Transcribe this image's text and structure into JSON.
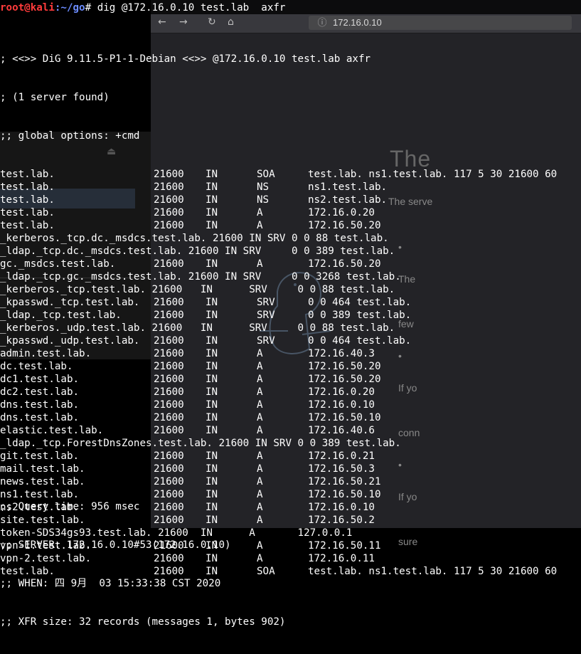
{
  "terminal": {
    "prompt_user": "root@kali",
    "prompt_path": ":~/go",
    "prompt_symbol": "# ",
    "command": "dig @172.16.0.10 test.lab  axfr",
    "header_lines": [
      "; <<>> DiG 9.11.5-P1-1-Debian <<>> @172.16.0.10 test.lab axfr",
      "; (1 server found)",
      ";; global options: +cmd"
    ],
    "records": [
      {
        "name": "test.lab.",
        "ttl": "21600",
        "class": "IN",
        "type": "SOA",
        "data": "test.lab. ns1.test.lab. 117 5 30 21600 60"
      },
      {
        "name": "test.lab.",
        "ttl": "21600",
        "class": "IN",
        "type": "NS",
        "data": "ns1.test.lab."
      },
      {
        "name": "test.lab.",
        "ttl": "21600",
        "class": "IN",
        "type": "NS",
        "data": "ns2.test.lab."
      },
      {
        "name": "test.lab.",
        "ttl": "21600",
        "class": "IN",
        "type": "A",
        "data": "172.16.0.20"
      },
      {
        "name": "test.lab.",
        "ttl": "21600",
        "class": "IN",
        "type": "A",
        "data": "172.16.50.20"
      },
      {
        "raw": "_kerberos._tcp.dc._msdcs.test.lab. 21600 IN SRV 0 0 88 test.lab."
      },
      {
        "raw": "_ldap._tcp.dc._msdcs.test.lab. 21600 IN SRV     0 0 389 test.lab."
      },
      {
        "name": "gc._msdcs.test.lab.",
        "ttl": "21600",
        "class": "IN",
        "type": "A",
        "data": "172.16.50.20"
      },
      {
        "raw": "_ldap._tcp.gc._msdcs.test.lab. 21600 IN SRV     0 0 3268 test.lab."
      },
      {
        "raw": "_kerberos._tcp.test.lab. 21600   IN      SRV     0 0 88 test.lab."
      },
      {
        "name": "_kpasswd._tcp.test.lab.",
        "ttl": "21600",
        "class": "IN",
        "type": "SRV",
        "data": "0 0 464 test.lab."
      },
      {
        "name": "_ldap._tcp.test.lab.",
        "ttl": "21600",
        "class": "IN",
        "type": "SRV",
        "data": "0 0 389 test.lab."
      },
      {
        "raw": "_kerberos._udp.test.lab. 21600   IN      SRV     0 0 88 test.lab."
      },
      {
        "name": "_kpasswd._udp.test.lab.",
        "ttl": "21600",
        "class": "IN",
        "type": "SRV",
        "data": "0 0 464 test.lab."
      },
      {
        "name": "admin.test.lab.",
        "ttl": "21600",
        "class": "IN",
        "type": "A",
        "data": "172.16.40.3"
      },
      {
        "name": "dc.test.lab.",
        "ttl": "21600",
        "class": "IN",
        "type": "A",
        "data": "172.16.50.20"
      },
      {
        "name": "dc1.test.lab.",
        "ttl": "21600",
        "class": "IN",
        "type": "A",
        "data": "172.16.50.20"
      },
      {
        "name": "dc2.test.lab.",
        "ttl": "21600",
        "class": "IN",
        "type": "A",
        "data": "172.16.0.20"
      },
      {
        "name": "dns.test.lab.",
        "ttl": "21600",
        "class": "IN",
        "type": "A",
        "data": "172.16.0.10"
      },
      {
        "name": "dns.test.lab.",
        "ttl": "21600",
        "class": "IN",
        "type": "A",
        "data": "172.16.50.10"
      },
      {
        "name": "elastic.test.lab.",
        "ttl": "21600",
        "class": "IN",
        "type": "A",
        "data": "172.16.40.6"
      },
      {
        "raw": "_ldap._tcp.ForestDnsZones.test.lab. 21600 IN SRV 0 0 389 test.lab."
      },
      {
        "name": "git.test.lab.",
        "ttl": "21600",
        "class": "IN",
        "type": "A",
        "data": "172.16.0.21"
      },
      {
        "name": "mail.test.lab.",
        "ttl": "21600",
        "class": "IN",
        "type": "A",
        "data": "172.16.50.3"
      },
      {
        "name": "news.test.lab.",
        "ttl": "21600",
        "class": "IN",
        "type": "A",
        "data": "172.16.50.21"
      },
      {
        "name": "ns1.test.lab.",
        "ttl": "21600",
        "class": "IN",
        "type": "A",
        "data": "172.16.50.10"
      },
      {
        "name": "ns2.test.lab.",
        "ttl": "21600",
        "class": "IN",
        "type": "A",
        "data": "172.16.0.10"
      },
      {
        "name": "site.test.lab.",
        "ttl": "21600",
        "class": "IN",
        "type": "A",
        "data": "172.16.50.2"
      },
      {
        "raw": "token-SDS34gs93.test.lab. 21600  IN      A       127.0.0.1"
      },
      {
        "name": "vpn-1.test.lab.",
        "ttl": "21600",
        "class": "IN",
        "type": "A",
        "data": "172.16.50.11"
      },
      {
        "name": "vpn-2.test.lab.",
        "ttl": "21600",
        "class": "IN",
        "type": "A",
        "data": "172.16.0.11"
      },
      {
        "name": "test.lab.",
        "ttl": "21600",
        "class": "IN",
        "type": "SOA",
        "data": "test.lab. ns1.test.lab. 117 5 30 21600 60"
      }
    ],
    "footer_lines": [
      ";; Query time: 956 msec",
      ";; SERVER: 172.16.0.10#53(172.16.0.10)",
      ";; WHEN: 四 9月  03 15:33:38 CST 2020",
      ";; XFR size: 32 records (messages 1, bytes 902)"
    ]
  },
  "browser": {
    "url": "172.16.0.10",
    "heading": "The",
    "subtext": "The serve",
    "bullets": [
      "The",
      "few",
      "If yo",
      "conn",
      "If yo",
      "sure"
    ]
  },
  "colors": {
    "prompt_user": "#ff3b3b",
    "prompt_path": "#6c8cff",
    "terminal_text": "#ffffff",
    "terminal_bg": "#000000"
  }
}
